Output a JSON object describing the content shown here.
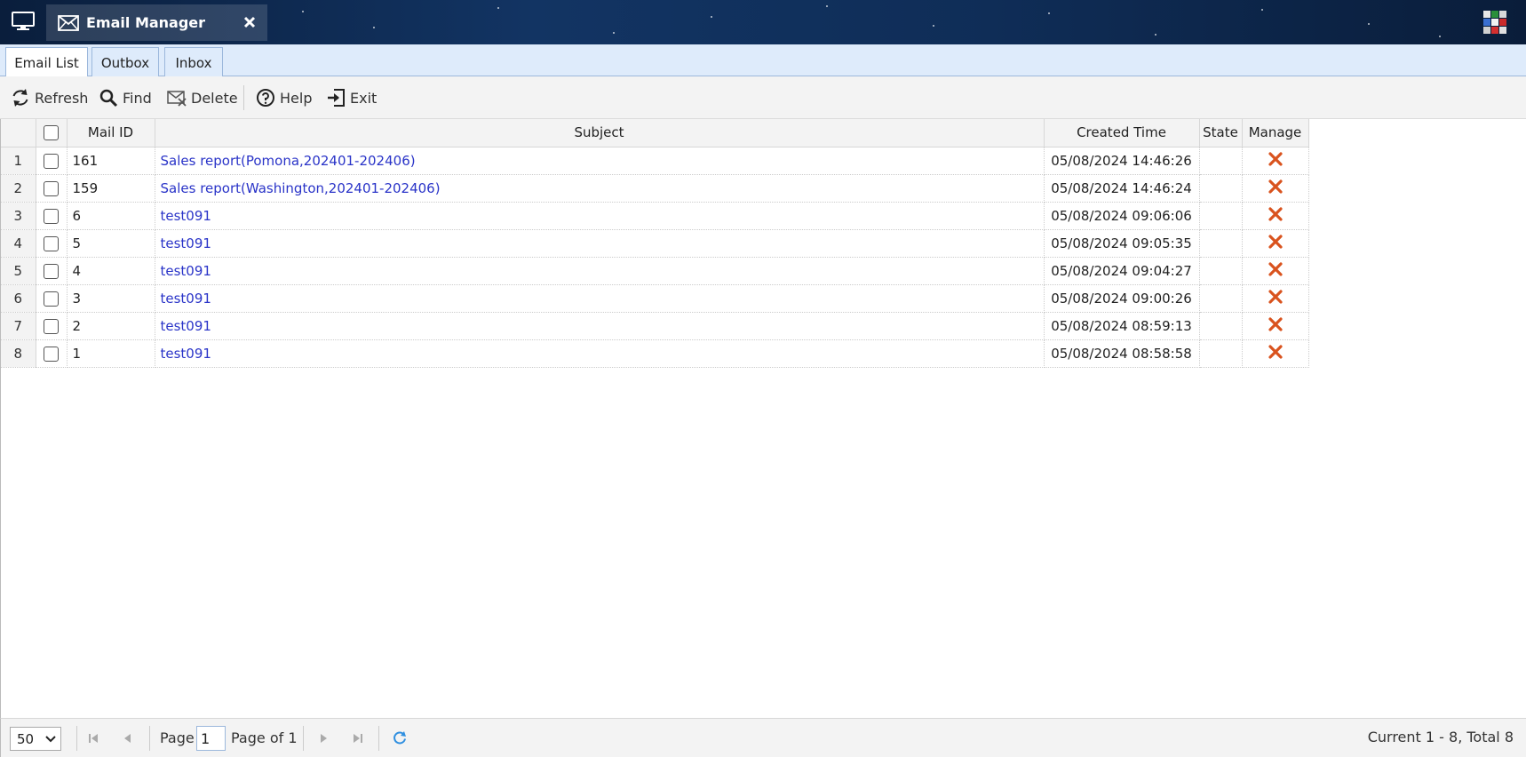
{
  "window": {
    "title": "Email Manager"
  },
  "tabs": [
    {
      "label": "Email List",
      "active": true
    },
    {
      "label": "Outbox",
      "active": false
    },
    {
      "label": "Inbox",
      "active": false
    }
  ],
  "toolbar": {
    "refresh": "Refresh",
    "find": "Find",
    "delete": "Delete",
    "help": "Help",
    "exit": "Exit"
  },
  "grid": {
    "columns": {
      "mail_id": "Mail ID",
      "subject": "Subject",
      "created_time": "Created Time",
      "state": "State",
      "manage": "Manage"
    },
    "rows": [
      {
        "num": "1",
        "id": "161",
        "subject": "Sales report(Pomona,202401-202406)",
        "time": "05/08/2024 14:46:26",
        "state": ""
      },
      {
        "num": "2",
        "id": "159",
        "subject": "Sales report(Washington,202401-202406)",
        "time": "05/08/2024 14:46:24",
        "state": ""
      },
      {
        "num": "3",
        "id": "6",
        "subject": "test091",
        "time": "05/08/2024 09:06:06",
        "state": ""
      },
      {
        "num": "4",
        "id": "5",
        "subject": "test091",
        "time": "05/08/2024 09:05:35",
        "state": ""
      },
      {
        "num": "5",
        "id": "4",
        "subject": "test091",
        "time": "05/08/2024 09:04:27",
        "state": ""
      },
      {
        "num": "6",
        "id": "3",
        "subject": "test091",
        "time": "05/08/2024 09:00:26",
        "state": ""
      },
      {
        "num": "7",
        "id": "2",
        "subject": "test091",
        "time": "05/08/2024 08:59:13",
        "state": ""
      },
      {
        "num": "8",
        "id": "1",
        "subject": "test091",
        "time": "05/08/2024 08:58:58",
        "state": ""
      }
    ]
  },
  "pager": {
    "page_size": "50",
    "page_label": "Page",
    "page_value": "1",
    "page_of": "Page of 1",
    "info": "Current 1 - 8, Total 8"
  },
  "colors": {
    "link": "#2a34c8",
    "delete_x": "#d9531e",
    "tab_bar": "#deebfb",
    "refresh_icon": "#2f8fe0"
  }
}
